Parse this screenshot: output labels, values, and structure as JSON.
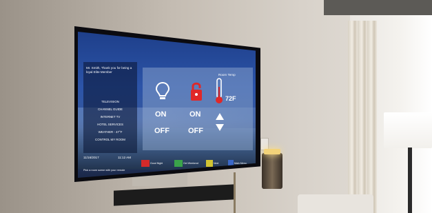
{
  "greeting": "Mr. Smith, Thank you for being a loyal Elite Member",
  "menu": [
    "TELEVISION",
    "CHANNEL GUIDE",
    "INTERNET TV",
    "HOTEL SERVICES",
    "WEATHER - 47°F",
    "CONTROL MY ROOM"
  ],
  "date": "11/16/2017",
  "time": "11:12 AM",
  "room_temp_label": "Room Temp",
  "lights": {
    "on": "ON",
    "off": "OFF"
  },
  "lock": {
    "on": "ON",
    "off": "OFF"
  },
  "thermostat": {
    "value": "72F"
  },
  "footer_buttons": [
    {
      "label": "Good Night",
      "color": "#d42a2a"
    },
    {
      "label": "Get Weekend",
      "color": "#3aa34a"
    },
    {
      "label": "Next",
      "color": "#d1c433"
    },
    {
      "label": "Main Menu",
      "color": "#3b68c8"
    }
  ],
  "hint": "Pick a room scene with your remote",
  "icons": [
    "lightbulb-icon",
    "lock-icon",
    "thermometer-icon",
    "arrow-up-icon",
    "arrow-down-icon"
  ]
}
